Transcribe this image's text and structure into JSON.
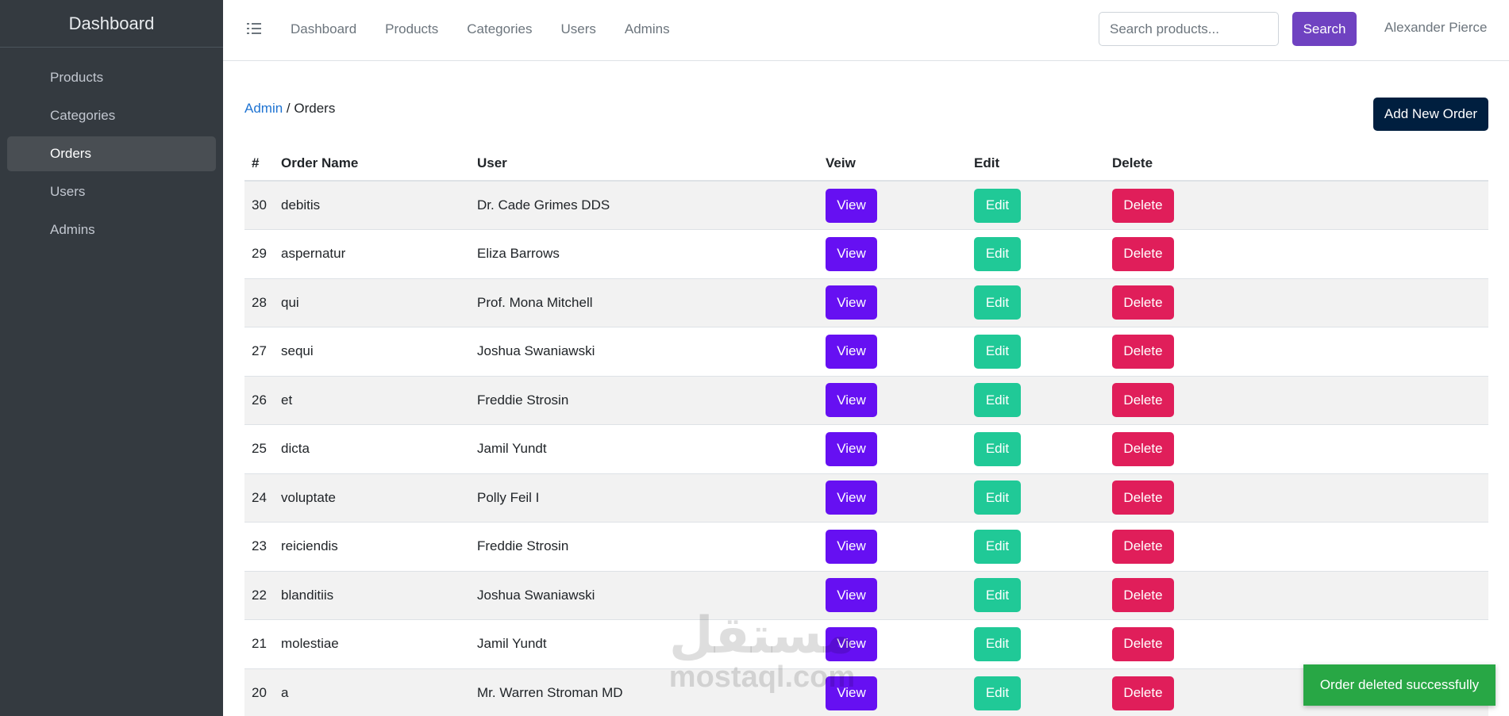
{
  "sidebar": {
    "brand": "Dashboard",
    "items": [
      {
        "label": "Products"
      },
      {
        "label": "Categories"
      },
      {
        "label": "Orders",
        "active": true
      },
      {
        "label": "Users"
      },
      {
        "label": "Admins"
      }
    ]
  },
  "topbar": {
    "links": [
      "Dashboard",
      "Products",
      "Categories",
      "Users",
      "Admins"
    ],
    "search_placeholder": "Search products...",
    "search_label": "Search",
    "user_name": "Alexander Pierce"
  },
  "breadcrumb": {
    "root": "Admin",
    "separator": " / ",
    "current": "Orders"
  },
  "add_button_label": "Add New Order",
  "table": {
    "headers": [
      "#",
      "Order Name",
      "User",
      "Veiw",
      "Edit",
      "Delete"
    ],
    "view_label": "View",
    "edit_label": "Edit",
    "delete_label": "Delete",
    "rows": [
      {
        "id": "30",
        "name": "debitis",
        "user": "Dr. Cade Grimes DDS"
      },
      {
        "id": "29",
        "name": "aspernatur",
        "user": "Eliza Barrows"
      },
      {
        "id": "28",
        "name": "qui",
        "user": "Prof. Mona Mitchell"
      },
      {
        "id": "27",
        "name": "sequi",
        "user": "Joshua Swaniawski"
      },
      {
        "id": "26",
        "name": "et",
        "user": "Freddie Strosin"
      },
      {
        "id": "25",
        "name": "dicta",
        "user": "Jamil Yundt"
      },
      {
        "id": "24",
        "name": "voluptate",
        "user": "Polly Feil I"
      },
      {
        "id": "23",
        "name": "reiciendis",
        "user": "Freddie Strosin"
      },
      {
        "id": "22",
        "name": "blanditiis",
        "user": "Joshua Swaniawski"
      },
      {
        "id": "21",
        "name": "molestiae",
        "user": "Jamil Yundt"
      },
      {
        "id": "20",
        "name": "a",
        "user": "Mr. Warren Stroman MD"
      }
    ]
  },
  "watermark": {
    "logo": "مستقل",
    "text": "mostaql.com"
  },
  "toast": {
    "message": "Order deleted successfully"
  },
  "colors": {
    "sidebar_bg": "#343a40",
    "search_button": "#6f42c1",
    "add_button": "#001f3f",
    "view_button": "#6610f2",
    "edit_button": "#20c997",
    "delete_button": "#e01e5a",
    "toast_bg": "#28a745",
    "link": "#1e73d2"
  }
}
